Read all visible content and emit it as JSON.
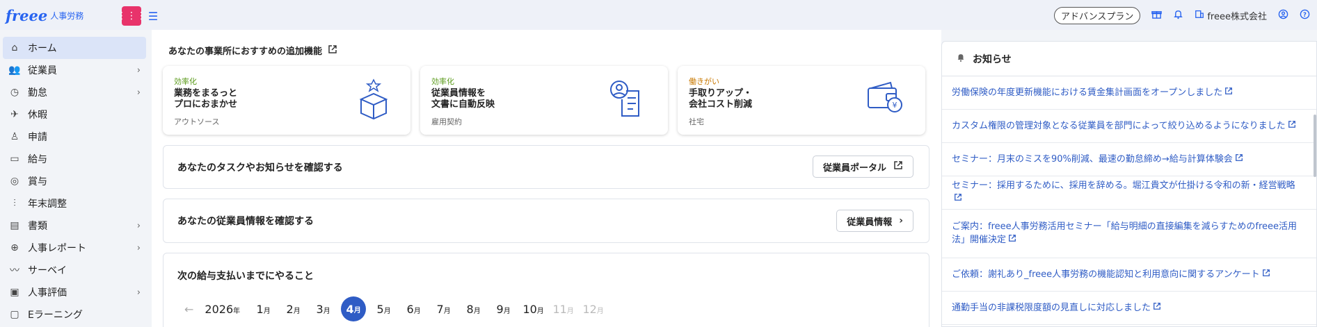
{
  "header": {
    "logo_text": "freee",
    "logo_sub": "人事労務",
    "plan_label": "アドバンスプラン",
    "company_name": "freee株式会社",
    "icons": [
      "apps-grid-icon",
      "sidebar-collapse-icon",
      "gift-icon",
      "bell-icon",
      "building-icon",
      "user-icon",
      "help-icon"
    ]
  },
  "sidebar": {
    "items": [
      {
        "label": "ホーム",
        "icon": "home-icon",
        "has_children": false,
        "active": true
      },
      {
        "label": "従業員",
        "icon": "people-icon",
        "has_children": true
      },
      {
        "label": "勤怠",
        "icon": "clock-icon",
        "has_children": true
      },
      {
        "label": "休暇",
        "icon": "plane-icon",
        "has_children": false
      },
      {
        "label": "申請",
        "icon": "stamp-icon",
        "has_children": false
      },
      {
        "label": "給与",
        "icon": "card-icon",
        "has_children": false
      },
      {
        "label": "賞与",
        "icon": "medal-icon",
        "has_children": false
      },
      {
        "label": "年末調整",
        "icon": "adjust-icon",
        "has_children": false
      },
      {
        "label": "書類",
        "icon": "document-icon",
        "has_children": true
      },
      {
        "label": "人事レポート",
        "icon": "report-icon",
        "has_children": true
      },
      {
        "label": "サーベイ",
        "icon": "survey-icon",
        "has_children": false
      },
      {
        "label": "人事評価",
        "icon": "evaluation-icon",
        "has_children": true
      },
      {
        "label": "Eラーニング",
        "icon": "elearning-icon",
        "has_children": false
      }
    ]
  },
  "main": {
    "recommend_title": "あなたの事業所におすすめの追加機能",
    "feature_cards": [
      {
        "tag": "効率化",
        "title": "業務をまるっと\nプロにおまかせ",
        "sub": "アウトソース",
        "icon": "box-icon"
      },
      {
        "tag": "効率化",
        "title": "従業員情報を\n文書に自動反映",
        "sub": "雇用契約",
        "icon": "contract-icon"
      },
      {
        "tag": "働きがい",
        "title": "手取りアップ・\n会社コスト削減",
        "sub": "社宅",
        "icon": "wallet-icon"
      }
    ],
    "tasks": {
      "title": "あなたのタスクやお知らせを確認する",
      "button": "従業員ポータル"
    },
    "employee_info": {
      "title": "あなたの従業員情報を確認する",
      "button": "従業員情報"
    },
    "payroll": {
      "title": "次の給与支払いまでにやること",
      "year": "2026",
      "year_unit": "年",
      "month_unit": "月",
      "months": [
        {
          "num": "1",
          "state": "normal"
        },
        {
          "num": "2",
          "state": "normal"
        },
        {
          "num": "3",
          "state": "normal"
        },
        {
          "num": "4",
          "state": "active"
        },
        {
          "num": "5",
          "state": "normal"
        },
        {
          "num": "6",
          "state": "normal"
        },
        {
          "num": "7",
          "state": "normal"
        },
        {
          "num": "8",
          "state": "normal"
        },
        {
          "num": "9",
          "state": "normal"
        },
        {
          "num": "10",
          "state": "normal"
        },
        {
          "num": "11",
          "state": "disabled"
        },
        {
          "num": "12",
          "state": "disabled"
        }
      ]
    }
  },
  "news": {
    "title": "お知らせ",
    "items": [
      "労働保険の年度更新機能における賃金集計画面をオープンしました",
      "カスタム権限の管理対象となる従業員を部門によって絞り込めるようになりました",
      "セミナー：月末のミスを90%削減、最速の勤怠締め→給与計算体験会",
      "セミナー：採用するために、採用を辞める。堀江貴文が仕掛ける令和の新・経営戦略",
      "ご案内：freee人事労務活用セミナー「給与明細の直接編集を減らすためのfreee活用法」開催決定",
      "ご依頼：謝礼あり_freee人事労務の機能認知と利用意向に関するアンケート",
      "通勤手当の非課税限度額の見直しに対応しました"
    ]
  }
}
